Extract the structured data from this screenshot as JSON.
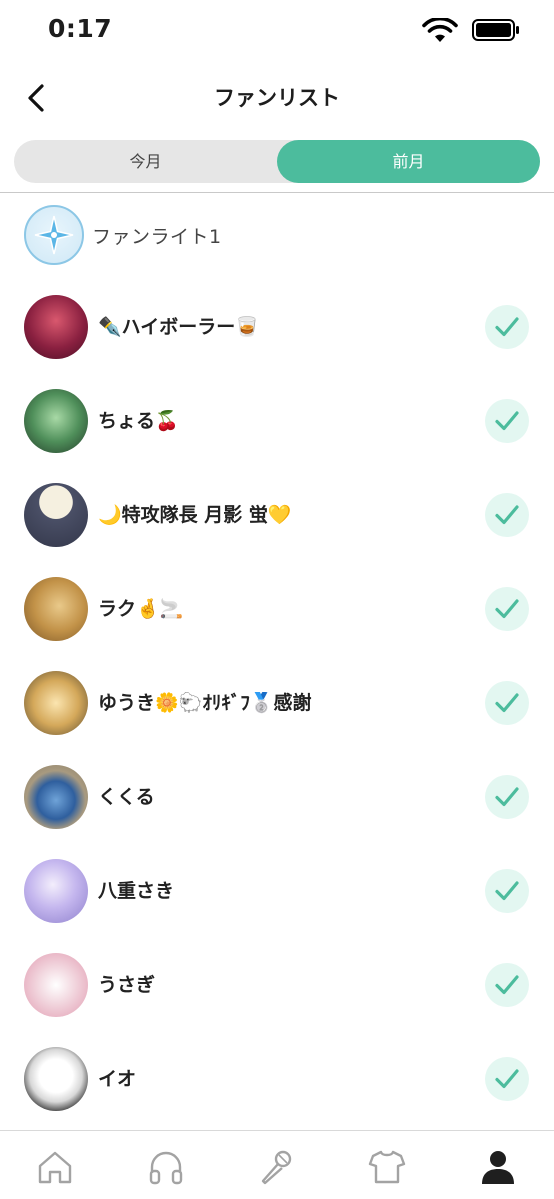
{
  "status_bar": {
    "time": "0:17"
  },
  "nav": {
    "title": "ファンリスト"
  },
  "segments": {
    "this_month": "今月",
    "last_month": "前月",
    "selected": "前月"
  },
  "rank": {
    "label": "ファンライト1"
  },
  "fans": [
    {
      "name": "✒️ハイボーラー🥃",
      "checked": true,
      "avatar_color": "#7a1f3a"
    },
    {
      "name": "ちょる🍒",
      "checked": true,
      "avatar_color": "#3f7a4a"
    },
    {
      "name": "🌙特攻隊長 月影 蛍💛",
      "checked": true,
      "avatar_color": "#3a3f55"
    },
    {
      "name": "ラク🤞🚬",
      "checked": true,
      "avatar_color": "#c89b4a"
    },
    {
      "name": "ゆうき🌼🐑ｵﾘｷﾞﾌ🥈感謝",
      "checked": true,
      "avatar_color": "#c9a060"
    },
    {
      "name": "くくる",
      "checked": true,
      "avatar_color": "#3f6fa8"
    },
    {
      "name": "八重さき",
      "checked": true,
      "avatar_color": "#a79bd6"
    },
    {
      "name": "うさぎ",
      "checked": true,
      "avatar_color": "#e6a9b8"
    },
    {
      "name": "イオ",
      "checked": true,
      "avatar_color": "#2a2a2a"
    }
  ],
  "tab_bar": {
    "items": [
      "home-icon",
      "headphones-icon",
      "microphone-icon",
      "tshirt-icon",
      "profile-icon"
    ],
    "active": "profile-icon"
  },
  "colors": {
    "accent": "#4cbc9d",
    "check_bg": "#e3f7f1"
  }
}
